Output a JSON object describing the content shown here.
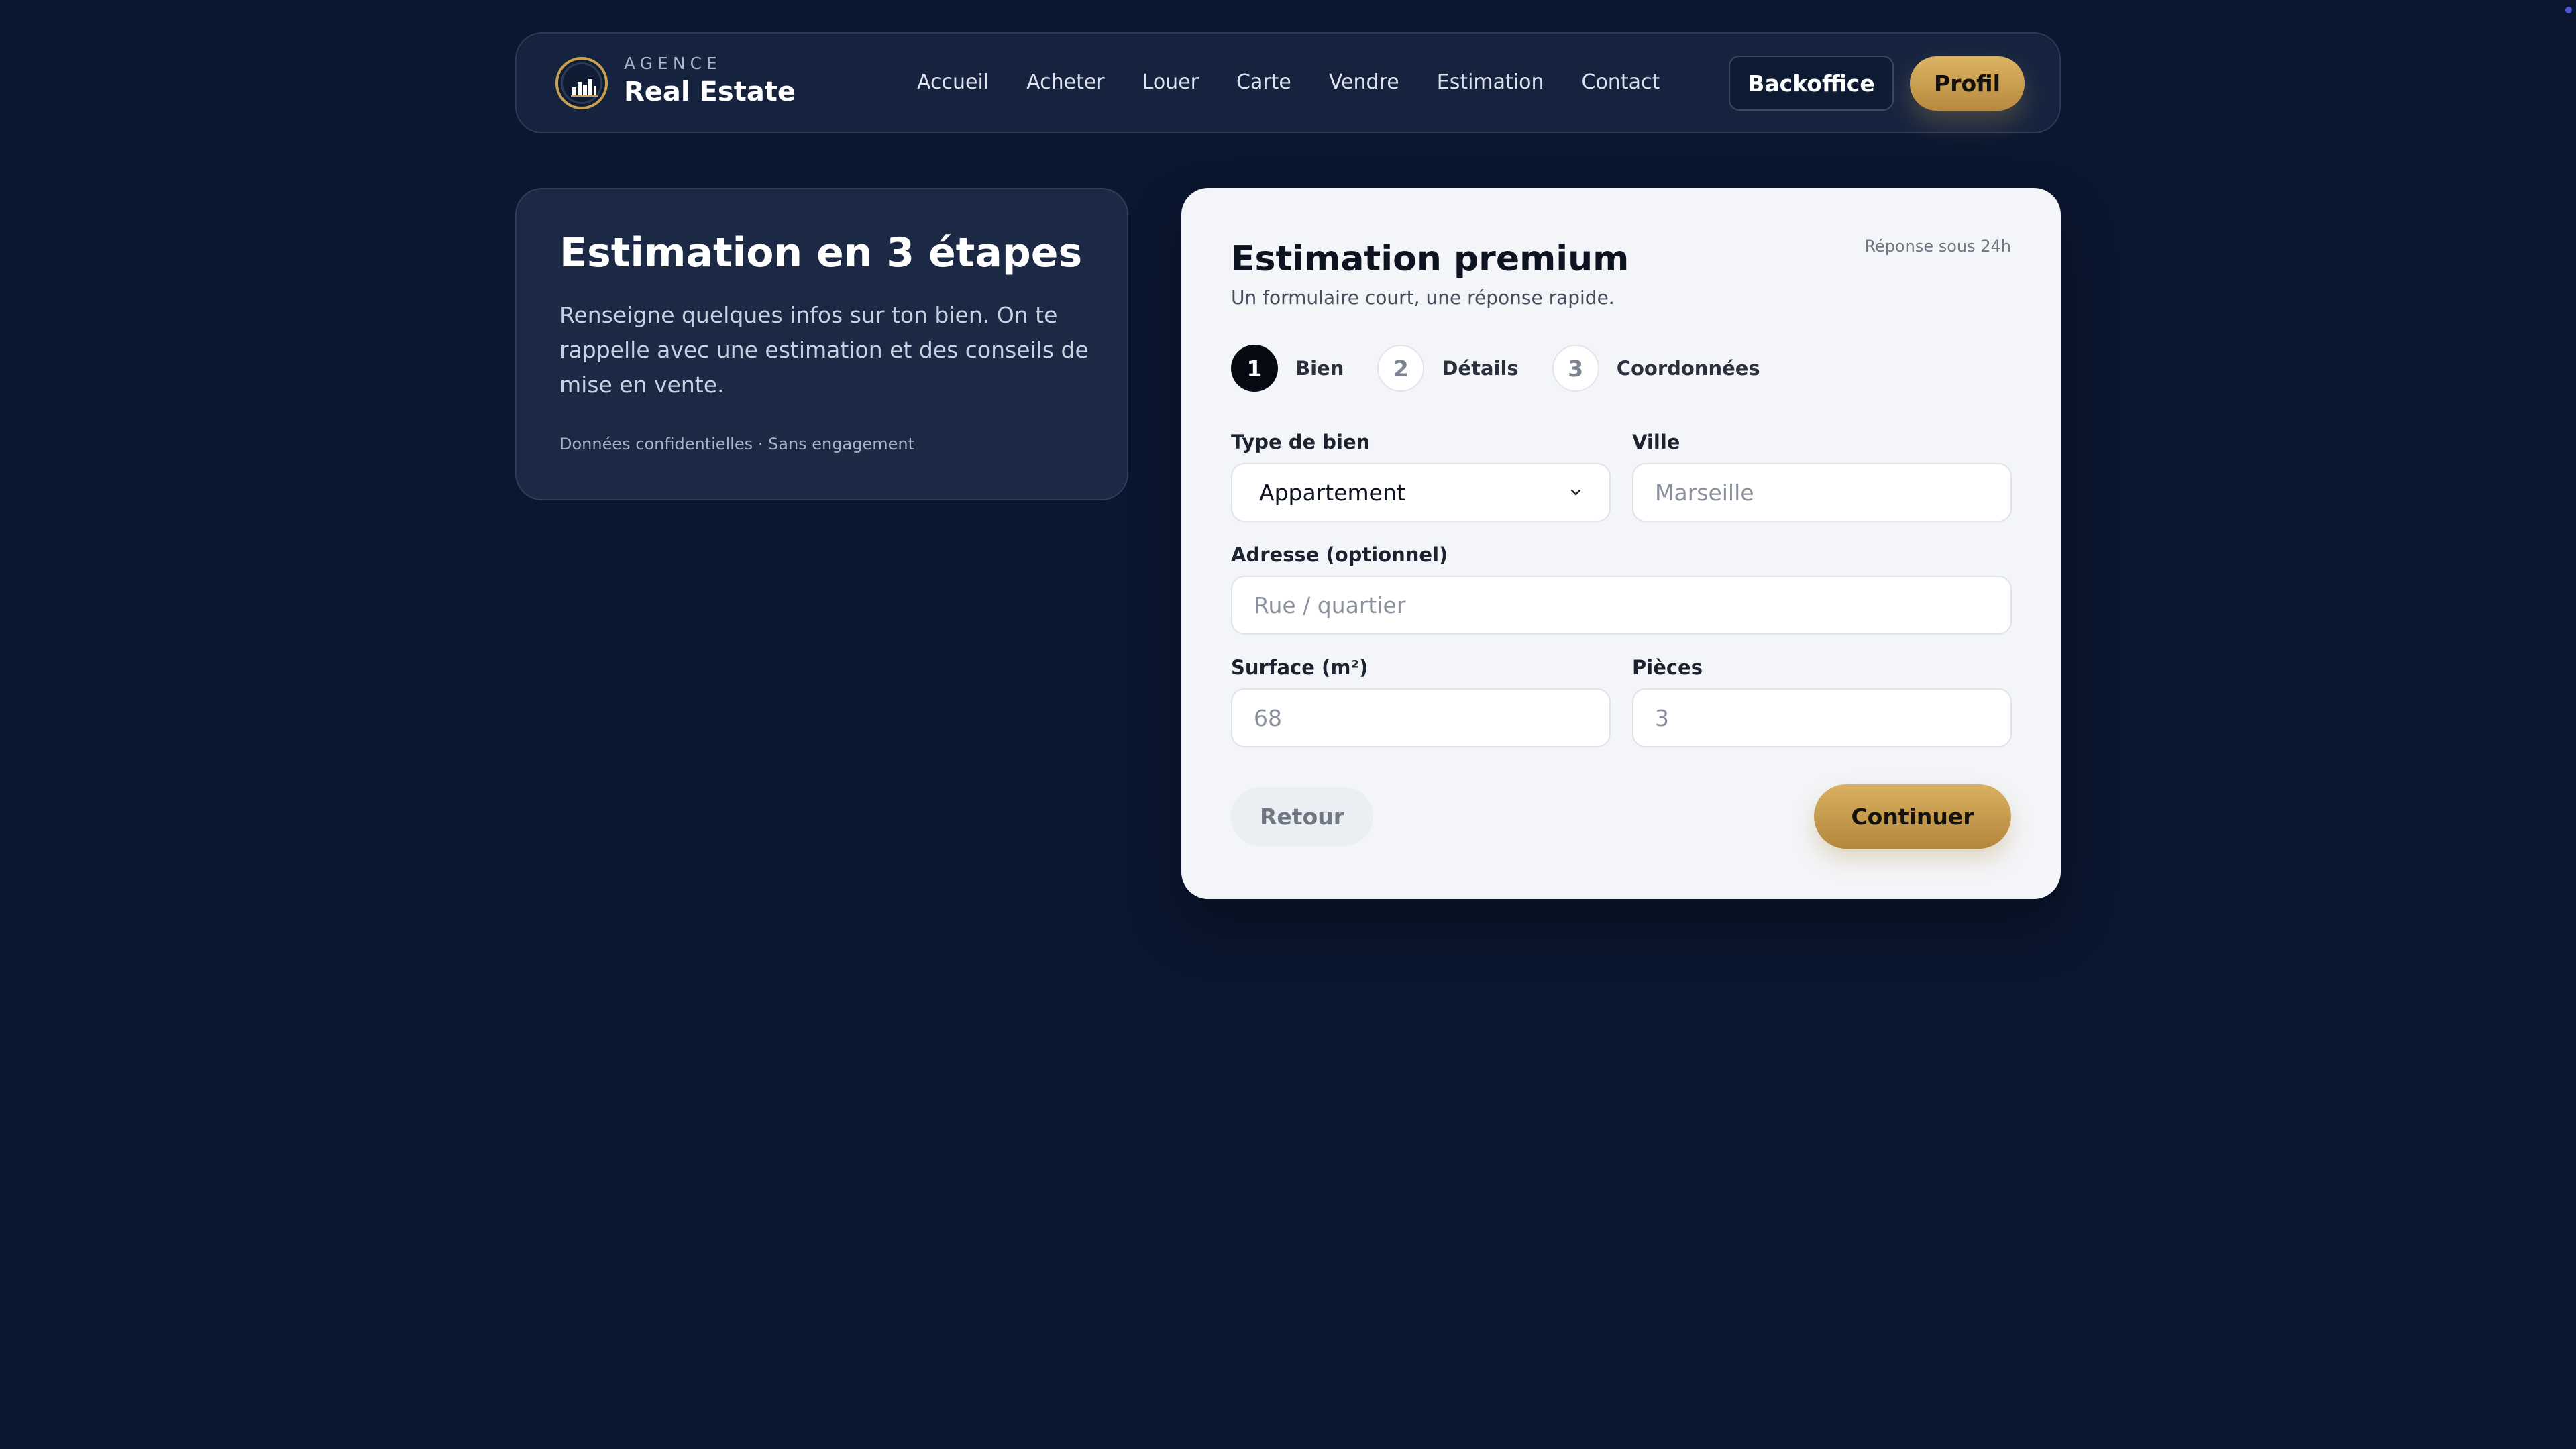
{
  "colors": {
    "page_background": "#0b1730",
    "nav_background": "#15233f",
    "accent_gold": "#c9a04e",
    "card_background": "#f3f5f8",
    "active_step": "#070a12"
  },
  "header": {
    "logo_icon": "city-skyline-icon",
    "brand_small": "AGENCE",
    "brand_name": "Real Estate",
    "nav": [
      {
        "label": "Accueil"
      },
      {
        "label": "Acheter"
      },
      {
        "label": "Louer"
      },
      {
        "label": "Carte"
      },
      {
        "label": "Vendre"
      },
      {
        "label": "Estimation"
      },
      {
        "label": "Contact"
      }
    ],
    "backoffice_label": "Backoffice",
    "profil_label": "Profil"
  },
  "intro": {
    "title": "Estimation en 3 étapes",
    "text": "Renseigne quelques infos sur ton bien. On te rappelle avec une estimation et des conseils de mise en vente.",
    "note": "Données confidentielles · Sans engagement"
  },
  "form": {
    "title": "Estimation premium",
    "badge": "Réponse sous 24h",
    "subtitle": "Un formulaire court, une réponse rapide.",
    "steps": [
      {
        "number": "1",
        "label": "Bien",
        "active": true
      },
      {
        "number": "2",
        "label": "Détails",
        "active": false
      },
      {
        "number": "3",
        "label": "Coordonnées",
        "active": false
      }
    ],
    "fields": {
      "type_label": "Type de bien",
      "type_value": "Appartement",
      "ville_label": "Ville",
      "ville_value": "",
      "ville_placeholder": "Marseille",
      "adresse_label": "Adresse (optionnel)",
      "adresse_value": "",
      "adresse_placeholder": "Rue / quartier",
      "surface_label": "Surface (m²)",
      "surface_value": "",
      "surface_placeholder": "68",
      "pieces_label": "Pièces",
      "pieces_value": "",
      "pieces_placeholder": "3"
    },
    "back_label": "Retour",
    "continue_label": "Continuer"
  }
}
